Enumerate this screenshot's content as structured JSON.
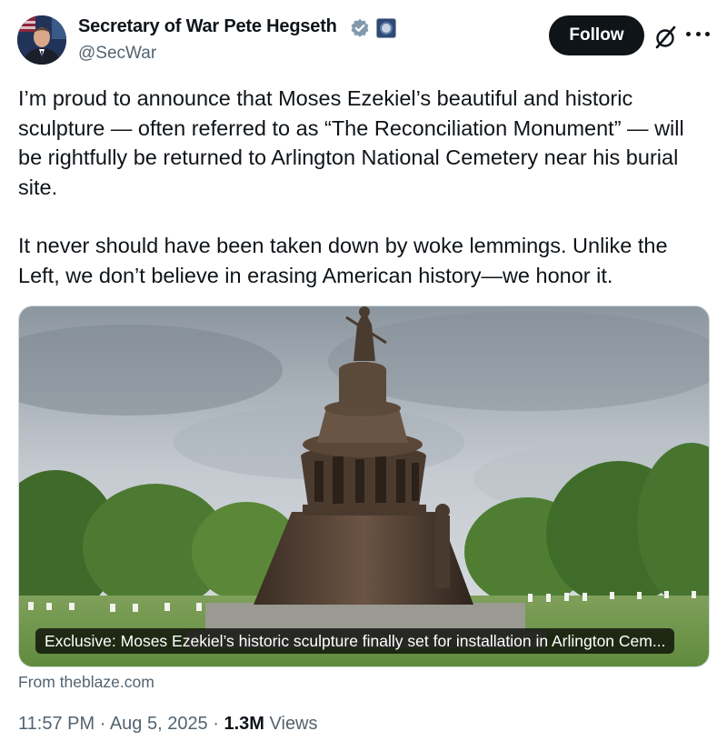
{
  "author": {
    "display_name": "Secretary of War Pete Hegseth",
    "handle": "@SecWar",
    "verified": true,
    "avatar_icon": "person-portrait-icon",
    "affiliation_icon": "government-seal-icon"
  },
  "actions": {
    "follow_label": "Follow",
    "grok_icon": "grok-icon",
    "more_icon": "more-options-icon"
  },
  "post": {
    "paragraphs": [
      "I’m proud to announce that Moses Ezekiel’s beautiful and historic sculpture — often referred to as “The Reconciliation Monument” — will be rightfully be returned to Arlington National Cemetery near his burial site.",
      "It never should have been taken down by woke lemmings. Unlike the Left, we don’t believe in erasing American history—we honor it."
    ]
  },
  "media": {
    "caption": "Exclusive: Moses Ezekiel’s historic sculpture finally set for installation in Arlington Cem...",
    "source": "From theblaze.com"
  },
  "meta": {
    "time": "11:57 PM",
    "date": "Aug 5, 2025",
    "separator": "·",
    "views_count": "1.3M",
    "views_label": "Views"
  },
  "colors": {
    "text_primary": "#0f1419",
    "text_secondary": "#536471",
    "verified_blue": "#829aab",
    "follow_bg": "#0f1419"
  }
}
